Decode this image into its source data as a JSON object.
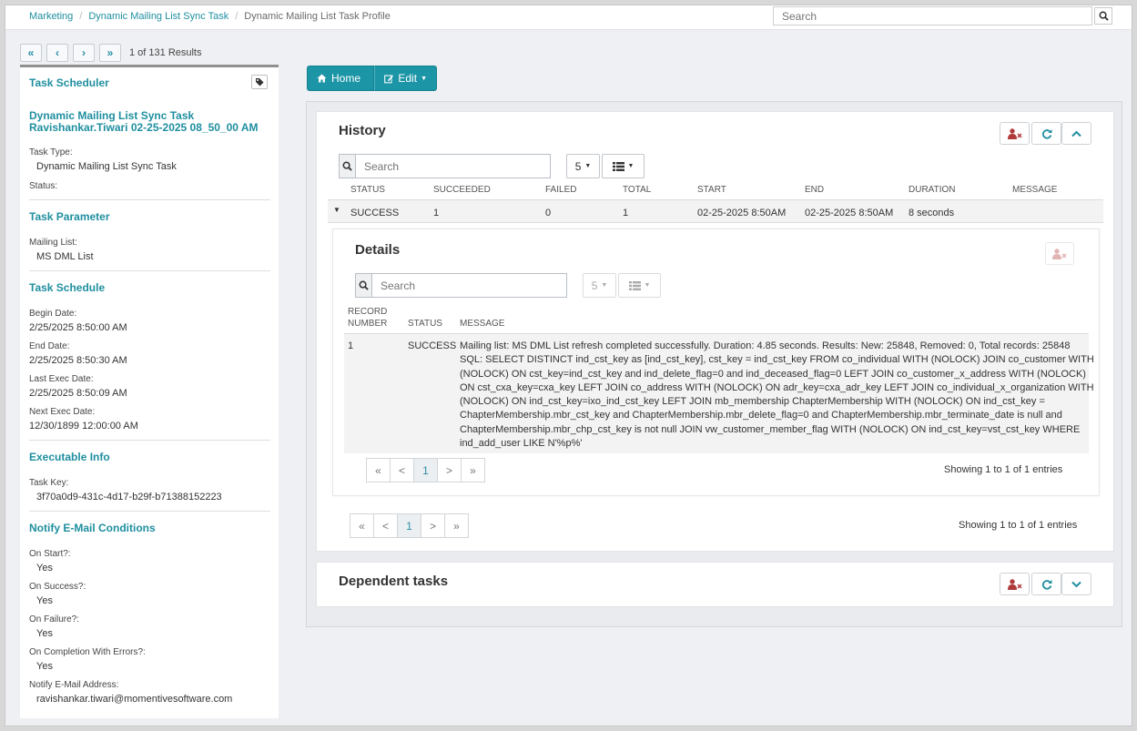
{
  "breadcrumb": {
    "items": [
      "Marketing",
      "Dynamic Mailing List Sync Task"
    ],
    "current": "Dynamic Mailing List Task Profile"
  },
  "global_search": {
    "placeholder": "Search"
  },
  "pager": {
    "first": "«",
    "prev": "‹",
    "next": "›",
    "last": "»",
    "results_text": "1 of 131 Results"
  },
  "left_panel": {
    "header": "Task Scheduler",
    "task_name": "Dynamic Mailing List Sync Task Ravishankar.Tiwari 02-25-2025 08_50_00 AM",
    "task_type_label": "Task Type:",
    "task_type_value": "Dynamic Mailing List Sync Task",
    "status_label": "Status:",
    "task_parameter_title": "Task Parameter",
    "mailing_list_label": "Mailing List:",
    "mailing_list_value": "MS DML List",
    "task_schedule_title": "Task Schedule",
    "begin_date_label": "Begin Date:",
    "begin_date_value": "2/25/2025 8:50:00 AM",
    "end_date_label": "End Date:",
    "end_date_value": "2/25/2025 8:50:30 AM",
    "last_exec_label": "Last Exec Date:",
    "last_exec_value": "2/25/2025 8:50:09 AM",
    "next_exec_label": "Next Exec Date:",
    "next_exec_value": "12/30/1899 12:00:00 AM",
    "executable_info_title": "Executable Info",
    "task_key_label": "Task Key:",
    "task_key_value": "3f70a0d9-431c-4d17-b29f-b71388152223",
    "notify_title": "Notify E-Mail Conditions",
    "on_start_label": "On Start?:",
    "on_start_value": "Yes",
    "on_success_label": "On Success?:",
    "on_success_value": "Yes",
    "on_failure_label": "On Failure?:",
    "on_failure_value": "Yes",
    "on_completion_label": "On Completion With Errors?:",
    "on_completion_value": "Yes",
    "notify_address_label": "Notify E-Mail Address:",
    "notify_address_value": "ravishankar.tiwari@momentivesoftware.com"
  },
  "actions": {
    "home_label": "Home",
    "edit_label": "Edit"
  },
  "history": {
    "title": "History",
    "search_placeholder": "Search",
    "page_size": "5",
    "columns": [
      "STATUS",
      "SUCCEEDED",
      "FAILED",
      "TOTAL",
      "START",
      "END",
      "DURATION",
      "MESSAGE"
    ],
    "row": {
      "status": "SUCCESS",
      "succeeded": "1",
      "failed": "0",
      "total": "1",
      "start": "02-25-2025 8:50AM",
      "end": "02-25-2025 8:50AM",
      "duration": "8 seconds",
      "message": ""
    },
    "pagination": {
      "first": "«",
      "prev": "<",
      "current": "1",
      "next": ">",
      "last": "»"
    },
    "showing": "Showing 1 to 1 of 1 entries"
  },
  "details": {
    "title": "Details",
    "search_placeholder": "Search",
    "page_size": "5",
    "col_record_number_line1": "RECORD",
    "col_record_number_line2": "NUMBER",
    "col_status": "STATUS",
    "col_message": "MESSAGE",
    "row": {
      "record_number": "1",
      "status": "SUCCESS",
      "message_lines": [
        "Mailing list: MS DML List refresh completed successfully. Duration: 4.85 seconds. Results: New: 25848, Removed: 0, Total records: 25848",
        "SQL: SELECT DISTINCT ind_cst_key as [ind_cst_key], cst_key = ind_cst_key FROM co_individual WITH (NOLOCK) JOIN co_customer WITH",
        "(NOLOCK) ON cst_key=ind_cst_key and ind_delete_flag=0 and ind_deceased_flag=0 LEFT JOIN co_customer_x_address WITH (NOLOCK)",
        "ON cst_cxa_key=cxa_key LEFT JOIN co_address WITH (NOLOCK) ON adr_key=cxa_adr_key LEFT JOIN co_individual_x_organization WITH",
        "(NOLOCK) ON ind_cst_key=ixo_ind_cst_key LEFT JOIN mb_membership ChapterMembership WITH (NOLOCK) ON ind_cst_key =",
        "ChapterMembership.mbr_cst_key and ChapterMembership.mbr_delete_flag=0 and ChapterMembership.mbr_terminate_date is null and",
        "ChapterMembership.mbr_chp_cst_key is not null JOIN vw_customer_member_flag WITH (NOLOCK) ON ind_cst_key=vst_cst_key WHERE",
        "ind_add_user LIKE N'%p%'"
      ]
    },
    "pagination": {
      "first": "«",
      "prev": "<",
      "current": "1",
      "next": ">",
      "last": "»"
    },
    "showing": "Showing 1 to 1 of 1 entries"
  },
  "dependent_tasks": {
    "title": "Dependent tasks"
  },
  "colors": {
    "accent": "#1c96a6",
    "link": "#1f8fa0",
    "danger_icon": "#b03a3a"
  }
}
